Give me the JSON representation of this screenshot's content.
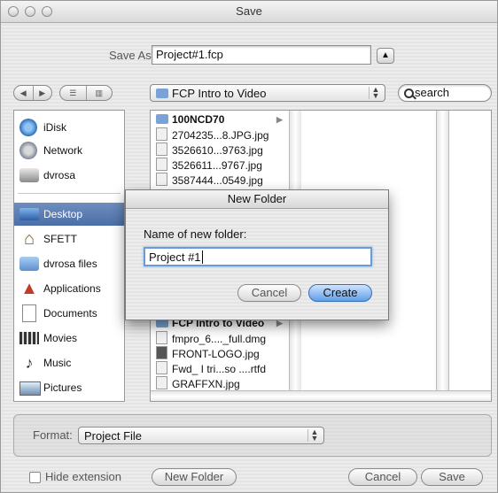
{
  "window": {
    "title": "Save"
  },
  "save_as": {
    "label": "Save As:",
    "value": "Project#1.fcp"
  },
  "location_popup": {
    "value": "FCP Intro to Video"
  },
  "search": {
    "placeholder": "search"
  },
  "sidebar": {
    "devices": [
      {
        "label": "iDisk",
        "icon": "idisk-icon"
      },
      {
        "label": "Network",
        "icon": "network-icon"
      },
      {
        "label": "dvrosa",
        "icon": "harddisk-icon"
      }
    ],
    "places": [
      {
        "label": "Desktop",
        "icon": "desktop-icon"
      },
      {
        "label": "SFETT",
        "icon": "home-icon"
      },
      {
        "label": "dvrosa files",
        "icon": "folder-icon"
      },
      {
        "label": "Applications",
        "icon": "applications-icon"
      },
      {
        "label": "Documents",
        "icon": "documents-icon"
      },
      {
        "label": "Movies",
        "icon": "movies-icon"
      },
      {
        "label": "Music",
        "icon": "music-icon"
      },
      {
        "label": "Pictures",
        "icon": "pictures-icon"
      }
    ]
  },
  "browser": {
    "top_files": [
      {
        "name": "100NCD70"
      },
      {
        "name": "2704235...8.JPG.jpg"
      },
      {
        "name": "3526610...9763.jpg"
      },
      {
        "name": "3526611...9767.jpg"
      },
      {
        "name": "3587444...0549.jpg"
      }
    ],
    "bottom_files": [
      {
        "name": "FCP Intro to Video"
      },
      {
        "name": "fmpro_6...._full.dmg"
      },
      {
        "name": "FRONT-LOGO.jpg"
      },
      {
        "name": "Fwd_ I tri...so ....rtfd"
      },
      {
        "name": "GRAFFXN.jpg"
      }
    ]
  },
  "format": {
    "label": "Format:",
    "value": "Project File"
  },
  "footer": {
    "hide_extension_label": "Hide extension",
    "new_folder_label": "New Folder",
    "cancel_label": "Cancel",
    "save_label": "Save"
  },
  "new_folder_dialog": {
    "title": "New Folder",
    "prompt": "Name of new folder:",
    "value": "Project #1",
    "cancel_label": "Cancel",
    "create_label": "Create"
  }
}
